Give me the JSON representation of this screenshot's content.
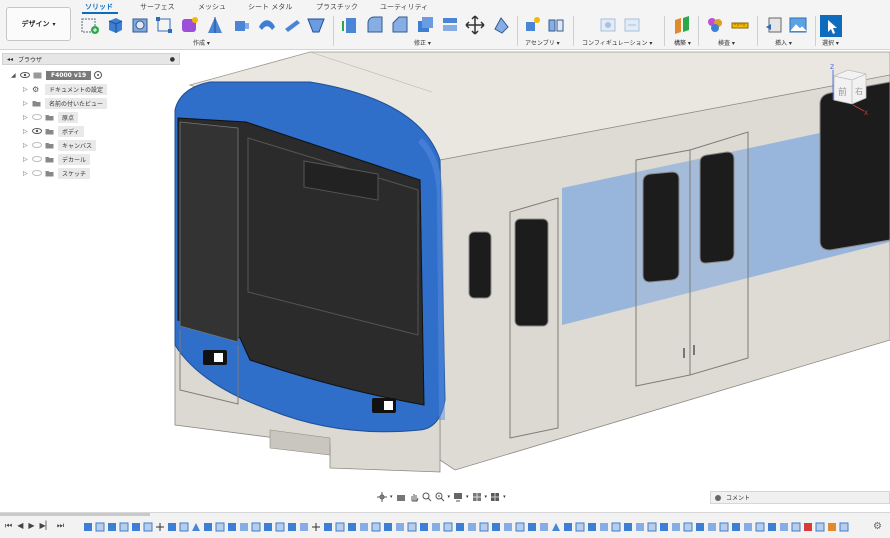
{
  "toolbar": {
    "design_label": "デザイン",
    "tabs": [
      "ソリッド",
      "サーフェス",
      "メッシュ",
      "シート メタル",
      "プラスチック",
      "ユーティリティ"
    ],
    "groups": [
      "作成",
      "修正",
      "アセンブリ",
      "コンフィギュレーション",
      "構築",
      "検査",
      "挿入",
      "選択"
    ]
  },
  "browser": {
    "title": "ブラウザ",
    "root": "F4000 v19",
    "items": [
      "ドキュメントの設定",
      "名前の付いたビュー",
      "原点",
      "ボディ",
      "キャンバス",
      "デカール",
      "スケッチ"
    ]
  },
  "comments": {
    "label": "コメント"
  },
  "viewcube": {
    "front": "前",
    "right": "右",
    "z": "Z",
    "x": "X"
  },
  "colors": {
    "accent": "#0f6cbd",
    "train_blue": "#2f6ec9",
    "train_body": "#dcd9d3",
    "stripe": "#94b3dc"
  }
}
